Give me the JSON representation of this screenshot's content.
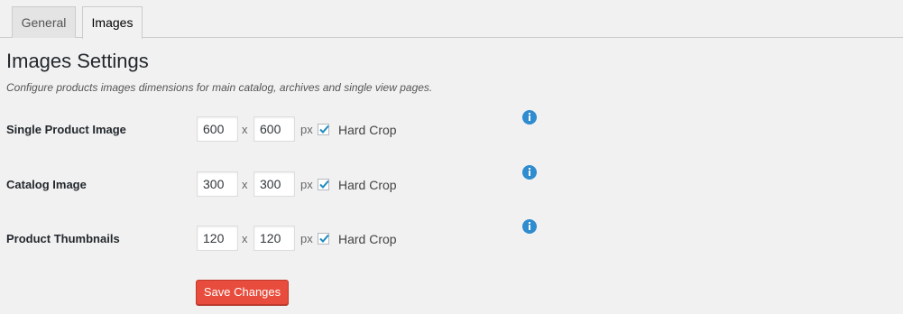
{
  "tabs": [
    {
      "label": "General",
      "active": false
    },
    {
      "label": "Images",
      "active": true
    }
  ],
  "page": {
    "title": "Images Settings",
    "description": "Configure products images dimensions for main catalog, archives and single view pages."
  },
  "rows": [
    {
      "label": "Single Product Image",
      "width": "600",
      "height": "600",
      "unit": "px",
      "separator": "x",
      "hard_crop": true,
      "hard_crop_label": "Hard Crop"
    },
    {
      "label": "Catalog Image",
      "width": "300",
      "height": "300",
      "unit": "px",
      "separator": "x",
      "hard_crop": true,
      "hard_crop_label": "Hard Crop"
    },
    {
      "label": "Product Thumbnails",
      "width": "120",
      "height": "120",
      "unit": "px",
      "separator": "x",
      "hard_crop": true,
      "hard_crop_label": "Hard Crop"
    }
  ],
  "save_button": {
    "label": "Save Changes"
  },
  "icons": {
    "info": "info-icon",
    "check": "checkmark-icon"
  },
  "colors": {
    "background": "#f1f1f1",
    "save_button": "#e74c3c",
    "info_icon": "#2e8ccf"
  }
}
